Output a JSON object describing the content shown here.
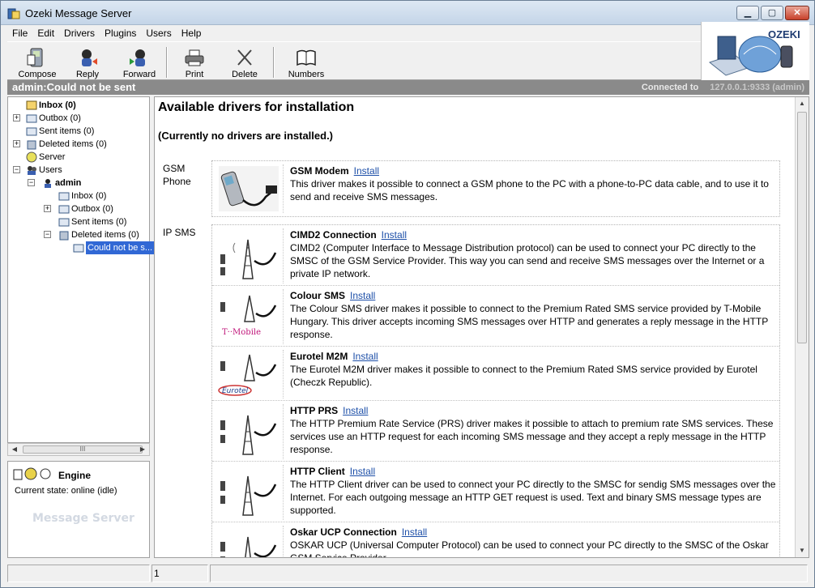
{
  "window": {
    "title": "Ozeki Message Server"
  },
  "menu": [
    "File",
    "Edit",
    "Drivers",
    "Plugins",
    "Users",
    "Help"
  ],
  "toolbar": {
    "compose": "Compose",
    "reply": "Reply",
    "forward": "Forward",
    "print": "Print",
    "delete": "Delete",
    "numbers": "Numbers"
  },
  "logo": {
    "text": "OZEKI"
  },
  "status": {
    "left": "admin:Could not be sent",
    "connected_label": "Connected to",
    "connected_value": "127.0.0.1:9333 (admin)"
  },
  "tree": {
    "inbox": "Inbox (0)",
    "outbox": "Outbox (0)",
    "sent": "Sent items (0)",
    "deleted": "Deleted items (0)",
    "server": "Server",
    "users": "Users",
    "admin": "admin",
    "admin_inbox": "Inbox (0)",
    "admin_outbox": "Outbox (0)",
    "admin_sent": "Sent items (0)",
    "admin_deleted": "Deleted items (0)",
    "could_not": "Could not be s..."
  },
  "scroll": {
    "grip": "III"
  },
  "engine": {
    "title": "Engine",
    "state": "Current state: online (idle)",
    "watermark": "Message Server"
  },
  "content": {
    "title": "Available drivers for installation",
    "subtitle": "(Currently no drivers are installed.)",
    "install_label": "Install",
    "categories": [
      {
        "name": "GSM Phone"
      },
      {
        "name": "IP SMS"
      }
    ],
    "drivers": {
      "gsm_modem": {
        "name": "GSM Modem",
        "desc": "This driver makes it possible to connect a GSM phone to the PC with a phone-to-PC data cable, and to use it to send and receive SMS messages."
      },
      "cimd2": {
        "name": "CIMD2 Connection",
        "desc": "CIMD2 (Computer Interface to Message Distribution protocol) can be used to connect your PC directly to the SMSC of the GSM Service Provider. This way you can send and receive SMS messages over the Internet or a private IP network."
      },
      "colour": {
        "name": "Colour SMS",
        "desc": "The Colour SMS driver makes it possible to connect to the Premium Rated SMS service provided by T-Mobile Hungary. This driver accepts incoming SMS messages over HTTP and generates a reply message in the HTTP response.",
        "logo": "T··Mobile"
      },
      "eurotel": {
        "name": "Eurotel M2M",
        "desc": "The Eurotel M2M driver makes it possible to connect to the Premium Rated SMS service provided by Eurotel (Checzk Republic).",
        "logo": "Eurotel"
      },
      "http_prs": {
        "name": "HTTP PRS",
        "desc": "The HTTP Premium Rate Service (PRS) driver makes it possible to attach to premium rate SMS services. These services use an HTTP request for each incoming SMS message and they accept a reply message in the HTTP response."
      },
      "http_client": {
        "name": "HTTP Client",
        "desc": "The HTTP Client driver can be used to connect your PC directly to the SMSC for sendig SMS messages over the Internet. For each outgoing message an HTTP GET request is used. Text and binary SMS message types are supported."
      },
      "oskar": {
        "name": "Oskar UCP Connection",
        "desc": "OSKAR UCP (Universal Computer Protocol) can be used to connect your PC directly to the SMSC of the Oskar GSM Service Provider."
      }
    }
  },
  "statusbar": {
    "cell2": "1"
  },
  "colors": {
    "accent": "#3168d5",
    "link": "#1d4fa8",
    "status_bg": "#8a8a8a"
  }
}
